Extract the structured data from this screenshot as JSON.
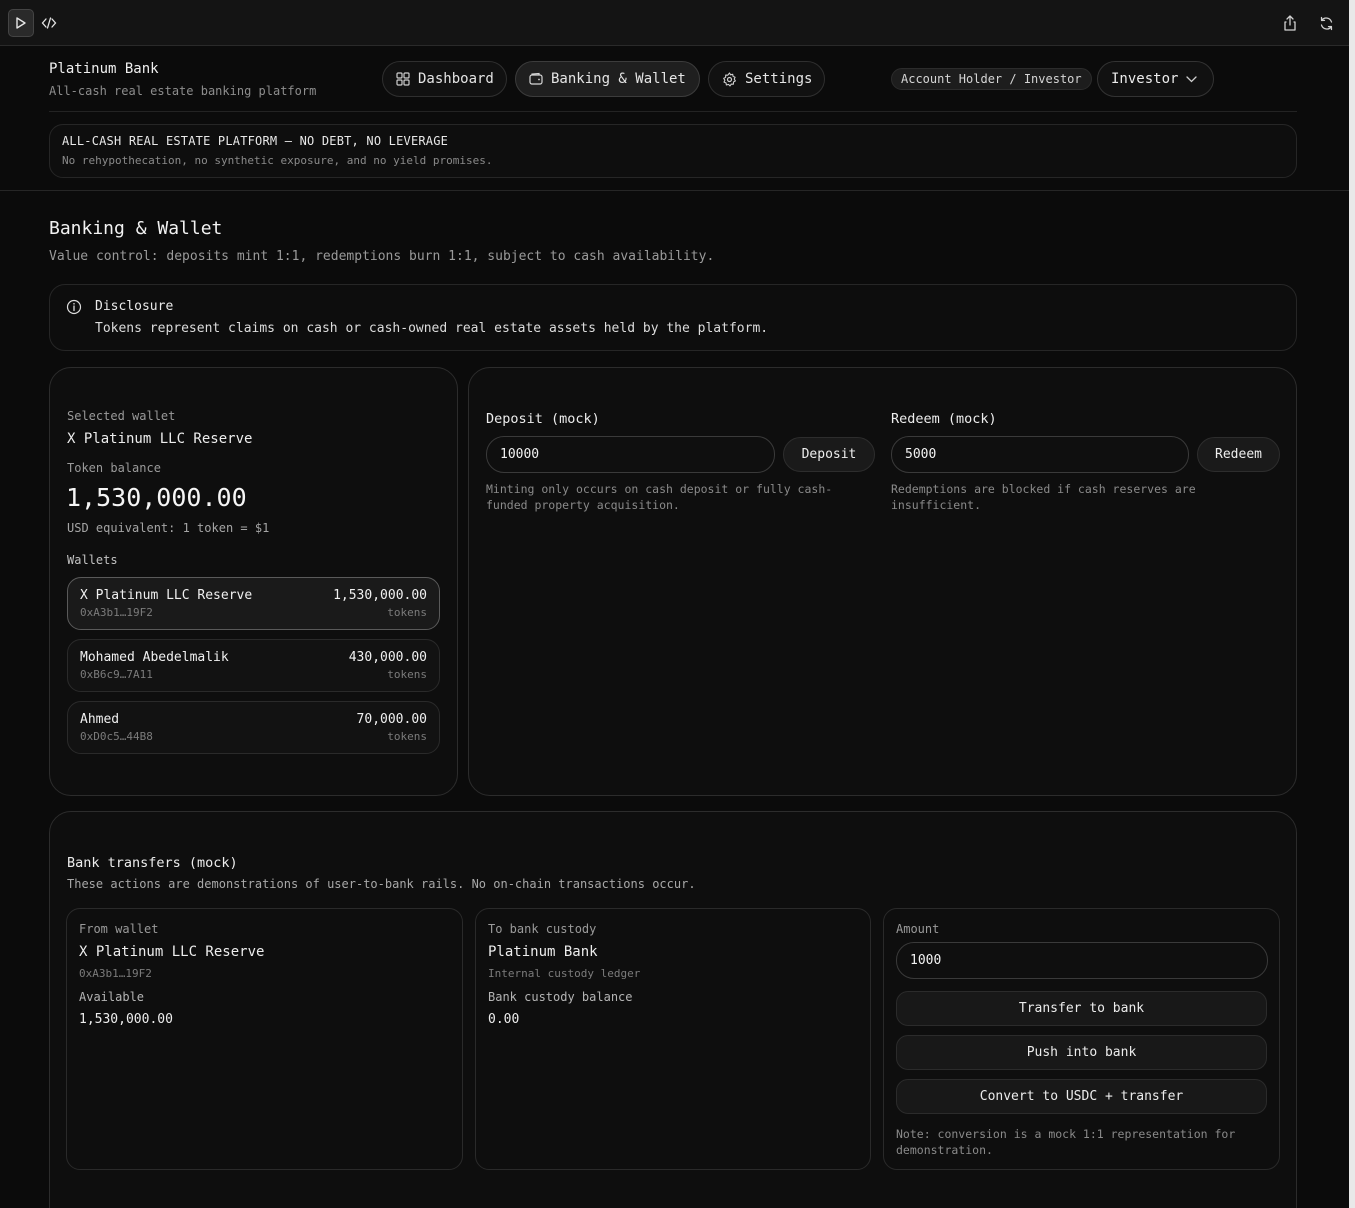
{
  "header": {
    "brand_title": "Platinum Bank",
    "brand_subtitle": "All-cash real estate banking platform",
    "nav": [
      {
        "label": "Dashboard",
        "icon": "grid-icon",
        "active": false
      },
      {
        "label": "Banking & Wallet",
        "icon": "wallet-icon",
        "active": true
      },
      {
        "label": "Settings",
        "icon": "gear-icon",
        "active": false
      }
    ],
    "role_badge": "Account Holder / Investor",
    "role_select": "Investor"
  },
  "banner": {
    "title": "ALL-CASH REAL ESTATE PLATFORM — NO DEBT, NO LEVERAGE",
    "subtitle": "No rehypothecation, no synthetic exposure, and no yield promises."
  },
  "page": {
    "title": "Banking & Wallet",
    "subtitle": "Value control: deposits mint 1:1, redemptions burn 1:1, subject to cash availability."
  },
  "disclosure": {
    "title": "Disclosure",
    "text": "Tokens represent claims on cash or cash-owned real estate assets held by the platform."
  },
  "wallet_panel": {
    "selected_label": "Selected wallet",
    "selected_name": "X Platinum LLC Reserve",
    "balance_label": "Token balance",
    "balance": "1,530,000.00",
    "usd_note": "USD equivalent: 1 token = $1",
    "wallets_label": "Wallets",
    "wallets": [
      {
        "name": "X Platinum LLC Reserve",
        "address": "0xA3b1…19F2",
        "balance": "1,530,000.00",
        "unit": "tokens"
      },
      {
        "name": "Mohamed Abedelmalik",
        "address": "0xB6c9…7A11",
        "balance": "430,000.00",
        "unit": "tokens"
      },
      {
        "name": "Ahmed",
        "address": "0xD0c5…44B8",
        "balance": "70,000.00",
        "unit": "tokens"
      }
    ]
  },
  "deposit": {
    "title": "Deposit (mock)",
    "value": "10000",
    "button": "Deposit",
    "hint": "Minting only occurs on cash deposit or fully cash-funded property acquisition."
  },
  "redeem": {
    "title": "Redeem (mock)",
    "value": "5000",
    "button": "Redeem",
    "hint": "Redemptions are blocked if cash reserves are insufficient."
  },
  "transfers": {
    "title": "Bank transfers (mock)",
    "subtitle": "These actions are demonstrations of user-to-bank rails. No on-chain transactions occur.",
    "from": {
      "label": "From wallet",
      "name": "X Platinum LLC Reserve",
      "address": "0xA3b1…19F2",
      "available_label": "Available",
      "available": "1,530,000.00"
    },
    "to": {
      "label": "To bank custody",
      "name": "Platinum Bank",
      "desc": "Internal custody ledger",
      "balance_label": "Bank custody balance",
      "balance": "0.00"
    },
    "amount": {
      "label": "Amount",
      "value": "1000",
      "buttons": [
        "Transfer to bank",
        "Push into bank",
        "Convert to USDC + transfer"
      ],
      "note": "Note: conversion is a mock 1:1 representation for demonstration."
    }
  }
}
